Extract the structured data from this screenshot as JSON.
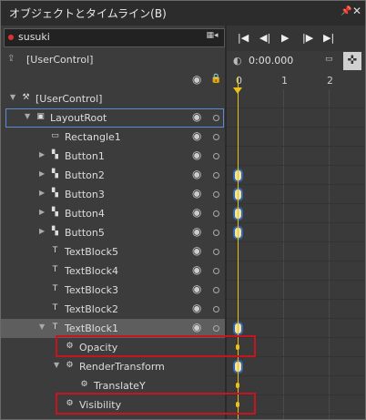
{
  "window": {
    "title": "オブジェクトとタイムライン(B)",
    "pin_icon": "pin-icon",
    "close_icon": "close-icon"
  },
  "search": {
    "value": "susuki",
    "button_icon": "filter-icon"
  },
  "scope": {
    "label": "[UserControl]"
  },
  "timeline_toolbar": {
    "buttons": [
      "go-to-first-icon",
      "prev-frame-icon",
      "play-icon",
      "next-frame-icon",
      "go-to-last-icon"
    ]
  },
  "time": {
    "value": "0:00.000"
  },
  "ruler": {
    "ticks": [
      "0",
      "1",
      "2"
    ]
  },
  "tree": [
    {
      "label": "[UserControl]",
      "indent": 0,
      "arrow": "▼",
      "icon": "⚒",
      "icon_name": "usercontrol-icon",
      "eye": false,
      "dot": false,
      "keyframe": "none"
    },
    {
      "label": "LayoutRoot",
      "indent": 1,
      "arrow": "▼",
      "icon": "▣",
      "icon_name": "grid-icon",
      "eye": true,
      "dot": true,
      "keyframe": "none",
      "selected": "blue"
    },
    {
      "label": "Rectangle1",
      "indent": 2,
      "arrow": "",
      "icon": "▭",
      "icon_name": "rectangle-icon",
      "eye": true,
      "dot": true,
      "keyframe": "none"
    },
    {
      "label": "Button1",
      "indent": 2,
      "arrow": "▶",
      "icon": "▚",
      "icon_name": "button-icon",
      "eye": true,
      "dot": true,
      "keyframe": "none"
    },
    {
      "label": "Button2",
      "indent": 2,
      "arrow": "▶",
      "icon": "▚",
      "icon_name": "button-icon",
      "eye": true,
      "dot": true,
      "keyframe": "big"
    },
    {
      "label": "Button3",
      "indent": 2,
      "arrow": "▶",
      "icon": "▚",
      "icon_name": "button-icon",
      "eye": true,
      "dot": true,
      "keyframe": "big"
    },
    {
      "label": "Button4",
      "indent": 2,
      "arrow": "▶",
      "icon": "▚",
      "icon_name": "button-icon",
      "eye": true,
      "dot": true,
      "keyframe": "big"
    },
    {
      "label": "Button5",
      "indent": 2,
      "arrow": "▶",
      "icon": "▚",
      "icon_name": "button-icon",
      "eye": true,
      "dot": true,
      "keyframe": "big"
    },
    {
      "label": "TextBlock5",
      "indent": 2,
      "arrow": "",
      "icon": "T",
      "icon_name": "textblock-icon",
      "eye": true,
      "dot": true,
      "keyframe": "none"
    },
    {
      "label": "TextBlock4",
      "indent": 2,
      "arrow": "",
      "icon": "T",
      "icon_name": "textblock-icon",
      "eye": true,
      "dot": true,
      "keyframe": "none"
    },
    {
      "label": "TextBlock3",
      "indent": 2,
      "arrow": "",
      "icon": "T",
      "icon_name": "textblock-icon",
      "eye": true,
      "dot": true,
      "keyframe": "none"
    },
    {
      "label": "TextBlock2",
      "indent": 2,
      "arrow": "",
      "icon": "T",
      "icon_name": "textblock-icon",
      "eye": true,
      "dot": true,
      "keyframe": "none"
    },
    {
      "label": "TextBlock1",
      "indent": 2,
      "arrow": "▼",
      "icon": "T",
      "icon_name": "textblock-icon",
      "eye": true,
      "dot": true,
      "keyframe": "big",
      "selected": "gray"
    },
    {
      "label": "Opacity",
      "indent": 3,
      "arrow": "",
      "icon": "⚙",
      "icon_name": "property-icon",
      "eye": false,
      "dot": false,
      "keyframe": "small",
      "highlight": true
    },
    {
      "label": "RenderTransform",
      "indent": 3,
      "arrow": "▼",
      "icon": "⚙",
      "icon_name": "property-icon",
      "eye": false,
      "dot": false,
      "keyframe": "big"
    },
    {
      "label": "TranslateY",
      "indent": 4,
      "arrow": "",
      "icon": "⚙",
      "icon_name": "property-icon",
      "eye": false,
      "dot": false,
      "keyframe": "small"
    },
    {
      "label": "Visibility",
      "indent": 3,
      "arrow": "",
      "icon": "⚙",
      "icon_name": "property-icon",
      "eye": false,
      "dot": false,
      "keyframe": "small",
      "highlight": true
    }
  ],
  "colors": {
    "accent": "#e8c21a",
    "keyframe_border": "#3566b0",
    "highlight_box": "#c8141e",
    "selection_outline": "#5a8ad8"
  }
}
